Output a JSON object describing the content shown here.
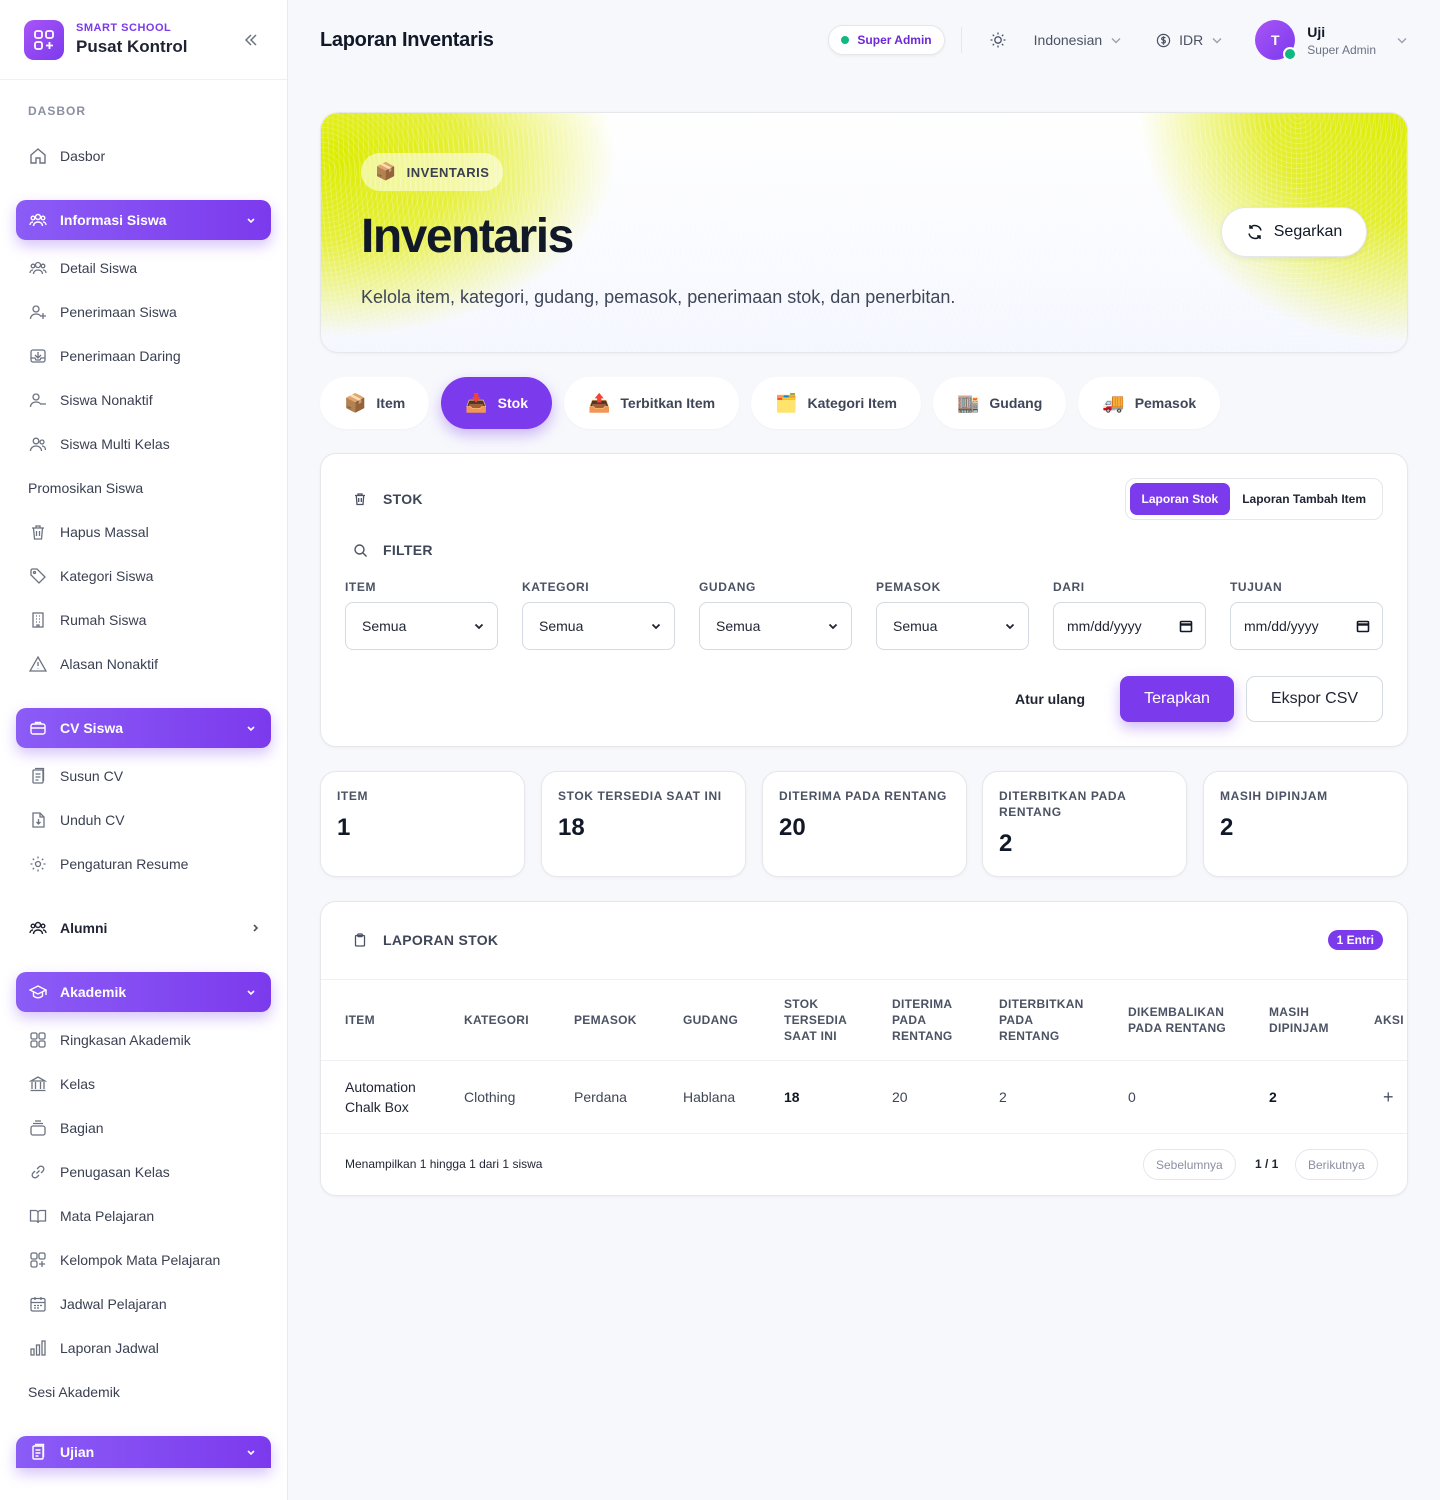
{
  "brand": {
    "small": "SMART SCHOOL",
    "name": "Pusat Kontrol"
  },
  "sidebar": {
    "section_dashboard": "DASBOR",
    "dashboard": "Dasbor",
    "group_student_info": "Informasi Siswa",
    "student_items": [
      "Detail Siswa",
      "Penerimaan Siswa",
      "Penerimaan Daring",
      "Siswa Nonaktif",
      "Siswa Multi Kelas",
      "Promosikan Siswa",
      "Hapus Massal",
      "Kategori Siswa",
      "Rumah Siswa",
      "Alasan Nonaktif"
    ],
    "group_cv": "CV Siswa",
    "cv_items": [
      "Susun CV",
      "Unduh CV",
      "Pengaturan Resume"
    ],
    "alumni": "Alumni",
    "group_academic": "Akademik",
    "academic_items": [
      "Ringkasan Akademik",
      "Kelas",
      "Bagian",
      "Penugasan Kelas",
      "Mata Pelajaran",
      "Kelompok Mata Pelajaran",
      "Jadwal Pelajaran",
      "Laporan Jadwal",
      "Sesi Akademik"
    ],
    "group_exam": "Ujian"
  },
  "header": {
    "title": "Laporan Inventaris",
    "role_badge": "Super Admin",
    "language": "Indonesian",
    "currency": "IDR",
    "user_initial": "T",
    "user_name": "Uji",
    "user_role": "Super Admin"
  },
  "hero": {
    "badge": "INVENTARIS",
    "badge_emoji": "📦",
    "title": "Inventaris",
    "subtitle": "Kelola item, kategori, gudang, pemasok, penerimaan stok, dan penerbitan.",
    "refresh": "Segarkan"
  },
  "tabs": [
    {
      "label": "Item",
      "emoji": "📦",
      "active": false
    },
    {
      "label": "Stok",
      "emoji": "📥",
      "active": true
    },
    {
      "label": "Terbitkan Item",
      "emoji": "📤",
      "active": false
    },
    {
      "label": "Kategori Item",
      "emoji": "🗂️",
      "active": false
    },
    {
      "label": "Gudang",
      "emoji": "🏬",
      "active": false
    },
    {
      "label": "Pemasok",
      "emoji": "🚚",
      "active": false
    }
  ],
  "filter_card": {
    "title": "STOK",
    "seg_stock_report": "Laporan Stok",
    "seg_add_item_report": "Laporan Tambah Item",
    "filter_title": "FILTER",
    "fields": [
      {
        "label": "ITEM",
        "value": "Semua"
      },
      {
        "label": "KATEGORI",
        "value": "Semua"
      },
      {
        "label": "GUDANG",
        "value": "Semua"
      },
      {
        "label": "PEMASOK",
        "value": "Semua"
      },
      {
        "label": "DARI",
        "value": "mm/dd/yyyy"
      },
      {
        "label": "TUJUAN",
        "value": "mm/dd/yyyy"
      }
    ],
    "reset": "Atur ulang",
    "apply": "Terapkan",
    "export": "Ekspor CSV"
  },
  "stats": [
    {
      "label": "ITEM",
      "value": "1"
    },
    {
      "label": "STOK TERSEDIA SAAT INI",
      "value": "18"
    },
    {
      "label": "DITERIMA PADA RENTANG",
      "value": "20"
    },
    {
      "label": "DITERBITKAN PADA RENTANG",
      "value": "2"
    },
    {
      "label": "MASIH DIPINJAM",
      "value": "2"
    }
  ],
  "report": {
    "title": "LAPORAN STOK",
    "entries": "1 Entri",
    "columns": [
      "ITEM",
      "KATEGORI",
      "PEMASOK",
      "GUDANG",
      "STOK TERSEDIA SAAT INI",
      "DITERIMA PADA RENTANG",
      "DITERBITKAN PADA RENTANG",
      "DIKEMBALIKAN PADA RENTANG",
      "MASIH DIPINJAM",
      "AKSI"
    ],
    "rows": [
      {
        "item": "Automation Chalk Box",
        "category": "Clothing",
        "supplier": "Perdana",
        "warehouse": "Hablana",
        "stock": "18",
        "received": "20",
        "issued": "2",
        "returned": "0",
        "borrowed": "2",
        "action": "+"
      }
    ],
    "showing": "Menampilkan 1 hingga 1 dari 1 siswa",
    "prev": "Sebelumnya",
    "page": "1 / 1",
    "next": "Berikutnya"
  },
  "colors": {
    "accent": "#7c3aed",
    "online": "#10b981",
    "hero_highlight": "#dcec00"
  }
}
